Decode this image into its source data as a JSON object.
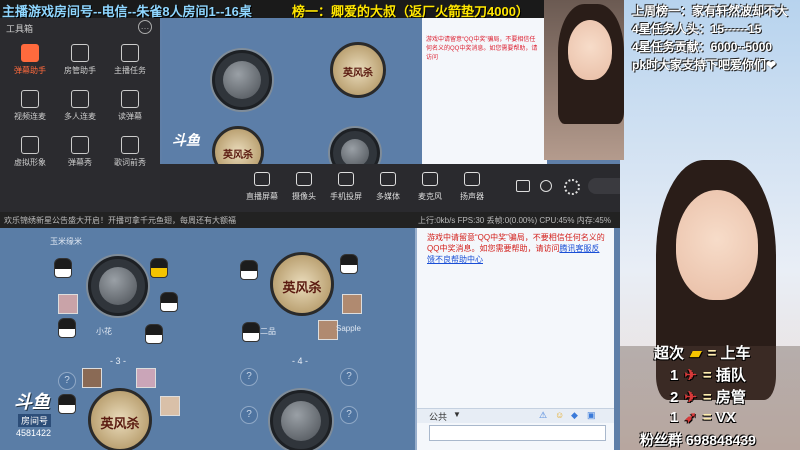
{
  "banner": {
    "title": "主播游戏房间号--电信--朱雀8人房间1--16桌",
    "ranking": "榜一：卿爱的大叔（返厂火箭垫刀4000）"
  },
  "tools": {
    "header": "工具箱",
    "items": [
      {
        "label": "弹幕助手",
        "active": true
      },
      {
        "label": "房管助手",
        "active": false
      },
      {
        "label": "主播任务",
        "active": false
      },
      {
        "label": "视频连麦",
        "active": false
      },
      {
        "label": "多人连麦",
        "active": false
      },
      {
        "label": "读弹幕",
        "active": false
      },
      {
        "label": "虚拟形象",
        "active": false
      },
      {
        "label": "弹幕秀",
        "active": false
      },
      {
        "label": "歌词前秀",
        "active": false
      }
    ]
  },
  "controls": {
    "items": [
      "直播屏幕",
      "摄像头",
      "手机投屏",
      "多媒体",
      "麦克风",
      "扬声器"
    ]
  },
  "stats": {
    "text": "欢乐锦绣新星公告盛大开启！开播可拿千元鱼翅，每周还有大额福",
    "metrics": "上行:0kb/s   FPS:30   丢帧:0(0.00%)   CPU:45%   内存:45%"
  },
  "game": {
    "table_numbers": [
      "- 3 -",
      "- 4 -"
    ],
    "question_mark": "?",
    "logo": "英风杀",
    "nicknames": [
      "玉米缘米",
      "小花",
      "二品",
      "Sapple"
    ],
    "room_watermark": "斗鱼",
    "room_label": "房间号",
    "room_id": "4581422"
  },
  "chat": {
    "message_prefix": "游戏中请留意“QQ中奖”骗局，不要相信任何名义的QQ中奖消息。如您需要帮助，请访问",
    "message_link": "腾讯客服反馈不良帮助中心",
    "channel": "公共"
  },
  "overlay": {
    "weekly_rank": "上周榜一：家有轩然波却不大",
    "task_heads": "4星任务人头：15------15",
    "task_contribution": "4星任务贡献：6000--5000",
    "pk_note": "pk时大家支持下吧爱你们❤",
    "legend": [
      {
        "count": "超次",
        "gift": "gold-bar",
        "meaning": "上车"
      },
      {
        "count": "1",
        "gift": "plane",
        "meaning": "插队"
      },
      {
        "count": "2",
        "gift": "plane",
        "meaning": "房管"
      },
      {
        "count": "1",
        "gift": "rocket",
        "meaning": "VX"
      }
    ],
    "fan_group": "粉丝群 698848439"
  },
  "colors": {
    "banner_text": "#8fd6ff",
    "ranking_text": "#ffe600",
    "active_tool": "#ff6a3d",
    "chat_warning": "#d3201c"
  }
}
